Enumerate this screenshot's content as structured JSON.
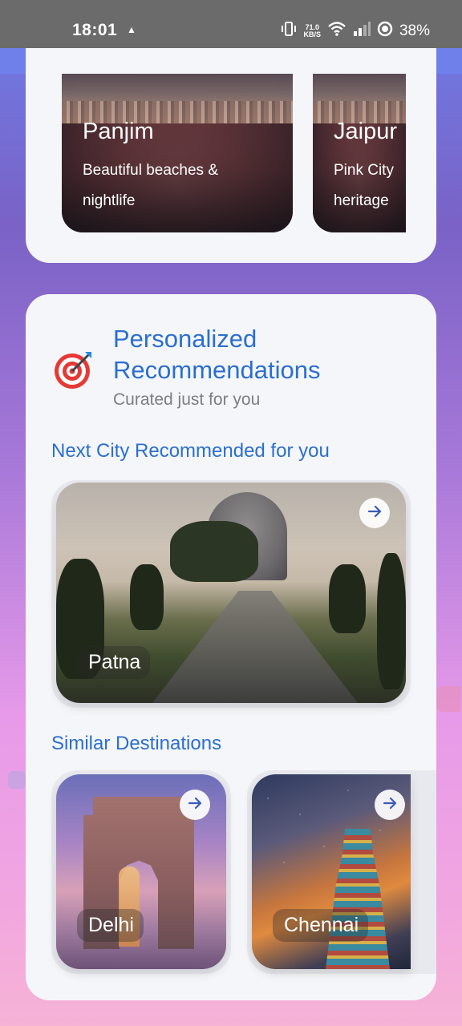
{
  "status_bar": {
    "time": "18:01",
    "net_speed_value": "71.0",
    "net_speed_unit": "KB/S",
    "battery": "38%"
  },
  "top_destinations": [
    {
      "name": "Panjim",
      "description": "Beautiful beaches & nightlife"
    },
    {
      "name": "Jaipur",
      "description": "Pink City heritage"
    }
  ],
  "recommendations": {
    "title": "Personalized Recommendations",
    "subtitle": "Curated just for you",
    "next_city_heading": "Next City Recommended for you",
    "next_city": {
      "name": "Patna"
    },
    "similar_heading": "Similar Destinations",
    "similar": [
      {
        "name": "Delhi"
      },
      {
        "name": "Chennai"
      }
    ]
  },
  "icons": {
    "recommendation": "target-icon",
    "open": "arrow-right-icon"
  },
  "colors": {
    "accent": "#2a6fd0",
    "card_background": "#f5f6f9",
    "muted_text": "#7d7d85"
  }
}
